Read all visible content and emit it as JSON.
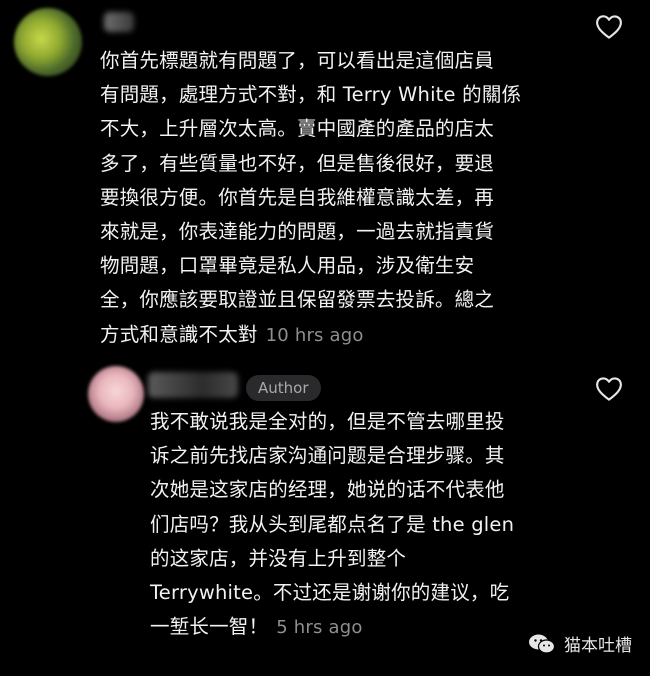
{
  "comments": [
    {
      "text": "你首先標題就有問題了，可以看出是這個店員\n有問題，處理方式不對，和 Terry White 的關係\n不大，上升層次太高。賣中國產的產品的店太\n多了，有些質量也不好，但是售後很好，要退\n要換很方便。你首先是自我維權意識太差，再\n來就是，你表達能力的問題，一過去就指責貨\n物問題，口罩畢竟是私人用品，涉及衛生安\n全，你應該要取證並且保留發票去投訴。總之\n方式和意識不太對",
      "timestamp": "10 hrs ago",
      "like_icon": "heart-outline-icon"
    },
    {
      "badge": "Author",
      "text": "我不敢说我是全对的，但是不管去哪里投\n诉之前先找店家沟通问题是合理步骤。其\n次她是这家店的经理，她说的话不代表他\n们店吗？我从头到尾都点名了是 the glen\n的这家店，并没有上升到整个\nTerrywhite。不过还是谢谢你的建议，吃\n一堑长一智！",
      "timestamp": "5 hrs ago",
      "like_icon": "heart-outline-icon"
    }
  ],
  "watermark": {
    "label": "猫本吐槽",
    "icon": "wechat-icon"
  },
  "colors": {
    "background": "#000000",
    "text": "#f2f2f2",
    "muted": "#8e8e93",
    "badge_bg": "#2a2a2c"
  }
}
